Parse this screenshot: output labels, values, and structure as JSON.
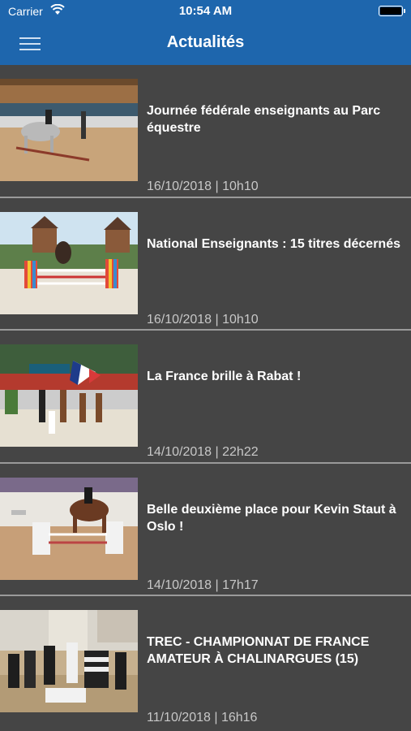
{
  "status": {
    "carrier": "Carrier",
    "time": "10:54 AM"
  },
  "header": {
    "title": "Actualités"
  },
  "news": [
    {
      "title": "Journée fédérale enseignants au Parc équestre",
      "date": "16/10/2018 | 10h10"
    },
    {
      "title": "National Enseignants : 15 titres décernés",
      "date": "16/10/2018 | 10h10"
    },
    {
      "title": "La France brille à Rabat !",
      "date": "14/10/2018 | 22h22"
    },
    {
      "title": "Belle deuxième place pour Kevin Staut à Oslo !",
      "date": "14/10/2018 | 17h17"
    },
    {
      "title": "TREC - CHAMPIONNAT DE FRANCE AMATEUR À CHALINARGUES (15)",
      "date": "11/10/2018 | 16h16"
    }
  ],
  "colors": {
    "header": "#1e66ad",
    "background": "#454545",
    "divider": "#9a9a9a"
  },
  "icons": {
    "menu": "hamburger-menu-icon",
    "wifi": "wifi-icon",
    "battery": "battery-icon"
  }
}
